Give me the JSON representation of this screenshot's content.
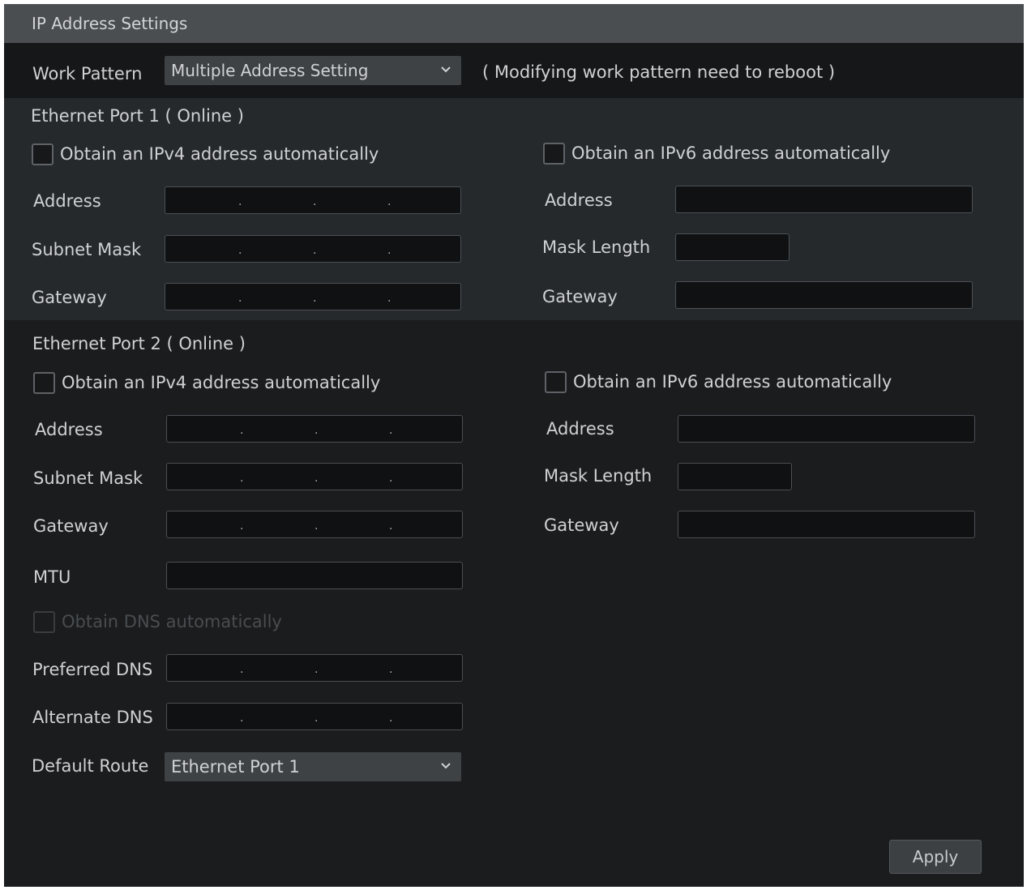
{
  "title": "IP Address Settings",
  "work_pattern": {
    "label": "Work Pattern",
    "value": "Multiple Address Setting",
    "note": "( Modifying work pattern need to reboot )"
  },
  "port1": {
    "header": "Ethernet Port 1 ( Online )",
    "ipv4_auto": "Obtain an IPv4 address automatically",
    "ipv6_auto": "Obtain an IPv6 address automatically",
    "address": "Address",
    "subnet": "Subnet Mask",
    "gateway": "Gateway",
    "v6_address": "Address",
    "mask_length": "Mask Length",
    "v6_gateway": "Gateway"
  },
  "port2": {
    "header": "Ethernet Port 2 ( Online )",
    "ipv4_auto": "Obtain an IPv4 address automatically",
    "ipv6_auto": "Obtain an IPv6 address automatically",
    "address": "Address",
    "subnet": "Subnet Mask",
    "gateway": "Gateway",
    "mtu": "MTU",
    "dns_auto": "Obtain DNS automatically",
    "preferred_dns": "Preferred DNS",
    "alternate_dns": "Alternate DNS",
    "default_route": "Default Route",
    "default_route_value": "Ethernet Port 1",
    "v6_address": "Address",
    "mask_length": "Mask Length",
    "v6_gateway": "Gateway"
  },
  "apply_label": "Apply",
  "icons": {
    "dropdown": "chevron-down-icon",
    "checkbox": "checkbox-icon"
  }
}
